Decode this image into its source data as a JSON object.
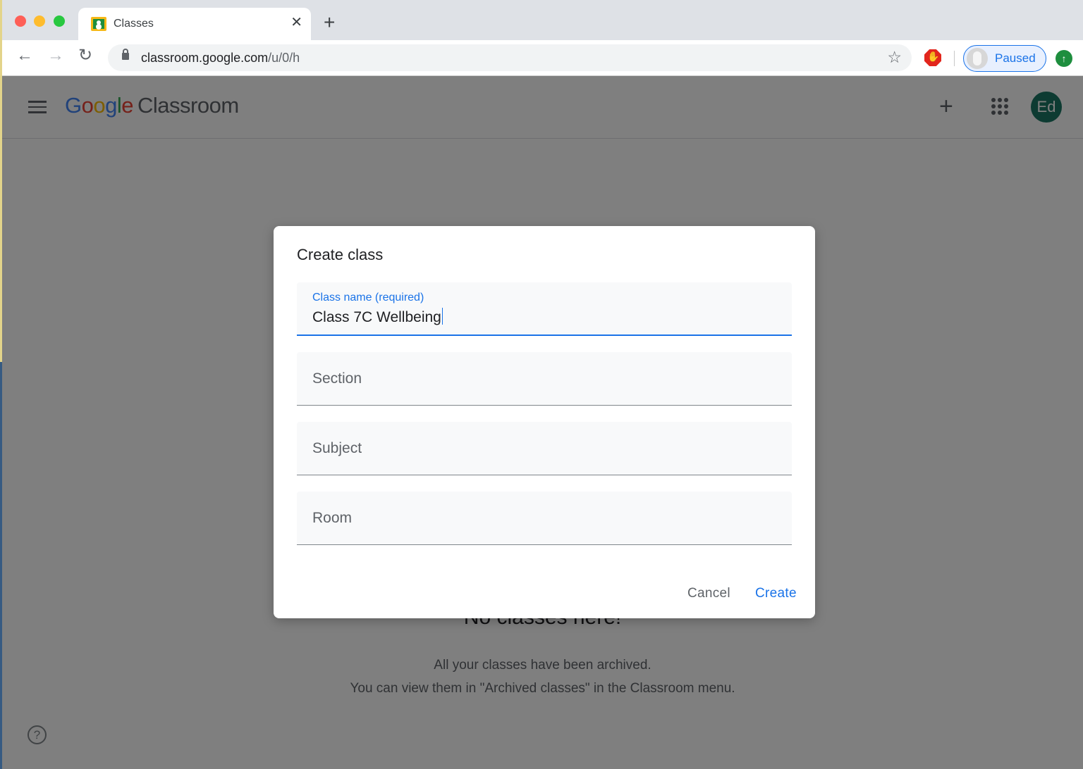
{
  "browser": {
    "tab": {
      "title": "Classes",
      "favicon": "google-classroom-icon",
      "close_glyph": "✕"
    },
    "new_tab_glyph": "+",
    "nav": {
      "back_glyph": "←",
      "forward_glyph": "→",
      "reload_glyph": "↻"
    },
    "url": {
      "host": "classroom.google.com",
      "path": "/u/0/h"
    },
    "bookmark_glyph": "☆",
    "profile": {
      "label": "Paused"
    },
    "update_glyph": "↑"
  },
  "app": {
    "logo": {
      "google_letters": [
        "G",
        "o",
        "o",
        "g",
        "l",
        "e"
      ],
      "product": "Classroom"
    },
    "add_glyph": "+",
    "avatar_initials": "Ed",
    "empty_state": {
      "title": "No classes here!",
      "line1": "All your classes have been archived.",
      "line2": "You can view them in \"Archived classes\" in the Classroom menu."
    },
    "help_glyph": "?"
  },
  "dialog": {
    "title": "Create class",
    "fields": [
      {
        "label": "Class name (required)",
        "value": "Class 7C Wellbeing",
        "focused": true
      },
      {
        "placeholder": "Section",
        "value": ""
      },
      {
        "placeholder": "Subject",
        "value": ""
      },
      {
        "placeholder": "Room",
        "value": ""
      }
    ],
    "cancel_label": "Cancel",
    "create_label": "Create"
  },
  "colors": {
    "accent": "#1a73e8",
    "avatar_bg": "#1a7765",
    "scrim": "rgba(0,0,0,0.5)"
  }
}
